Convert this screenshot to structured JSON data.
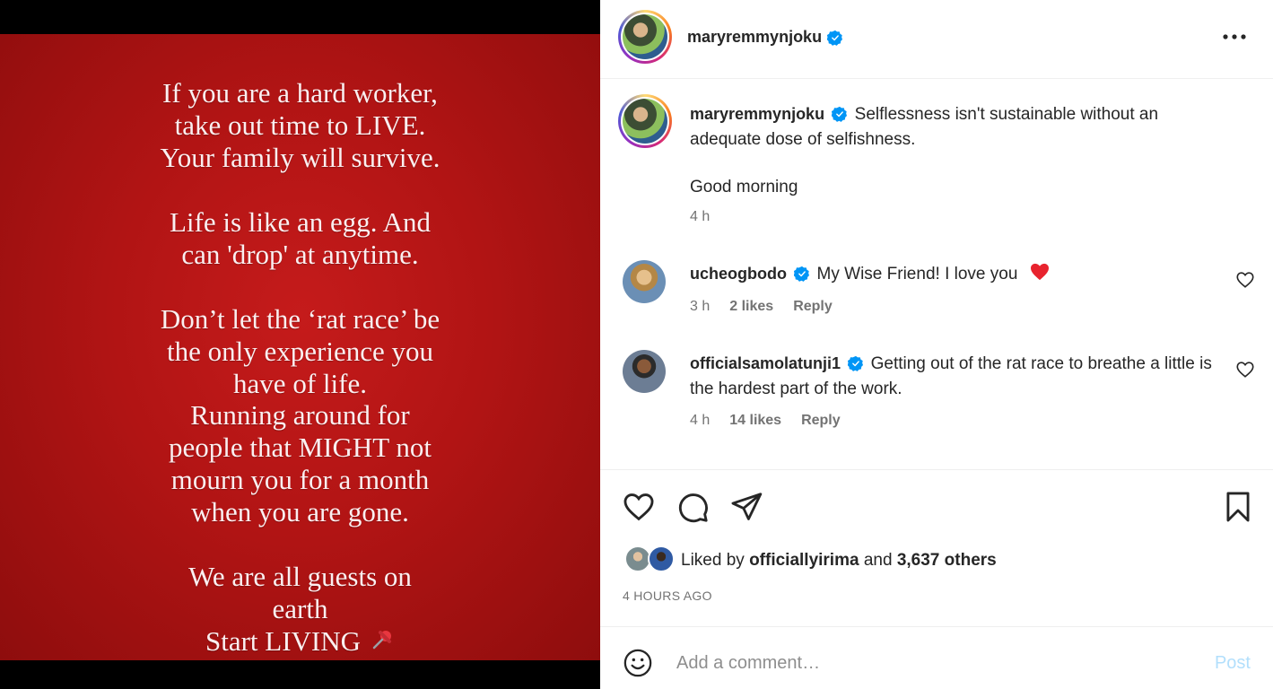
{
  "media": {
    "quote_block_1": [
      "If you are a hard worker,",
      "take out time to LIVE.",
      "Your family will survive."
    ],
    "quote_block_2": [
      "Life is like an egg. And",
      "can 'drop' at anytime."
    ],
    "quote_block_3": [
      "Don’t let the ‘rat race’ be",
      "the only experience you",
      "have of life.",
      "Running around for",
      "people that MIGHT not",
      "mourn you for a month",
      "when you are gone."
    ],
    "quote_block_4": [
      "We are all guests on",
      "earth",
      "Start LIVING"
    ],
    "background_color": "#b11414"
  },
  "header": {
    "username": "maryremmynjoku",
    "verified": true,
    "more_icon": "more-horizontal-icon"
  },
  "caption": {
    "username": "maryremmynjoku",
    "text": "Selflessness isn't sustainable without an adequate dose of selfishness.",
    "text2": "Good morning",
    "time": "4 h"
  },
  "comments": [
    {
      "username": "ucheogbodo",
      "text": "My Wise Friend! I love you",
      "time": "3 h",
      "likes": "2 likes",
      "reply": "Reply"
    },
    {
      "username": "officialsamolatunji1",
      "text": "Getting out of the rat race to breathe a little is the hardest part of the work.",
      "time": "4 h",
      "likes": "14 likes",
      "reply": "Reply"
    }
  ],
  "actions": {
    "liked_by_prefix": "Liked by",
    "liked_by_user": "officiallyirima",
    "liked_by_and": "and",
    "liked_by_others": "3,637 others",
    "time_ago": "4 HOURS AGO"
  },
  "add_comment": {
    "placeholder": "Add a comment…",
    "post_label": "Post"
  },
  "colors": {
    "verified_blue": "#0095f6",
    "heart_red": "#ed4956",
    "post_disabled": "#b2dffc"
  }
}
